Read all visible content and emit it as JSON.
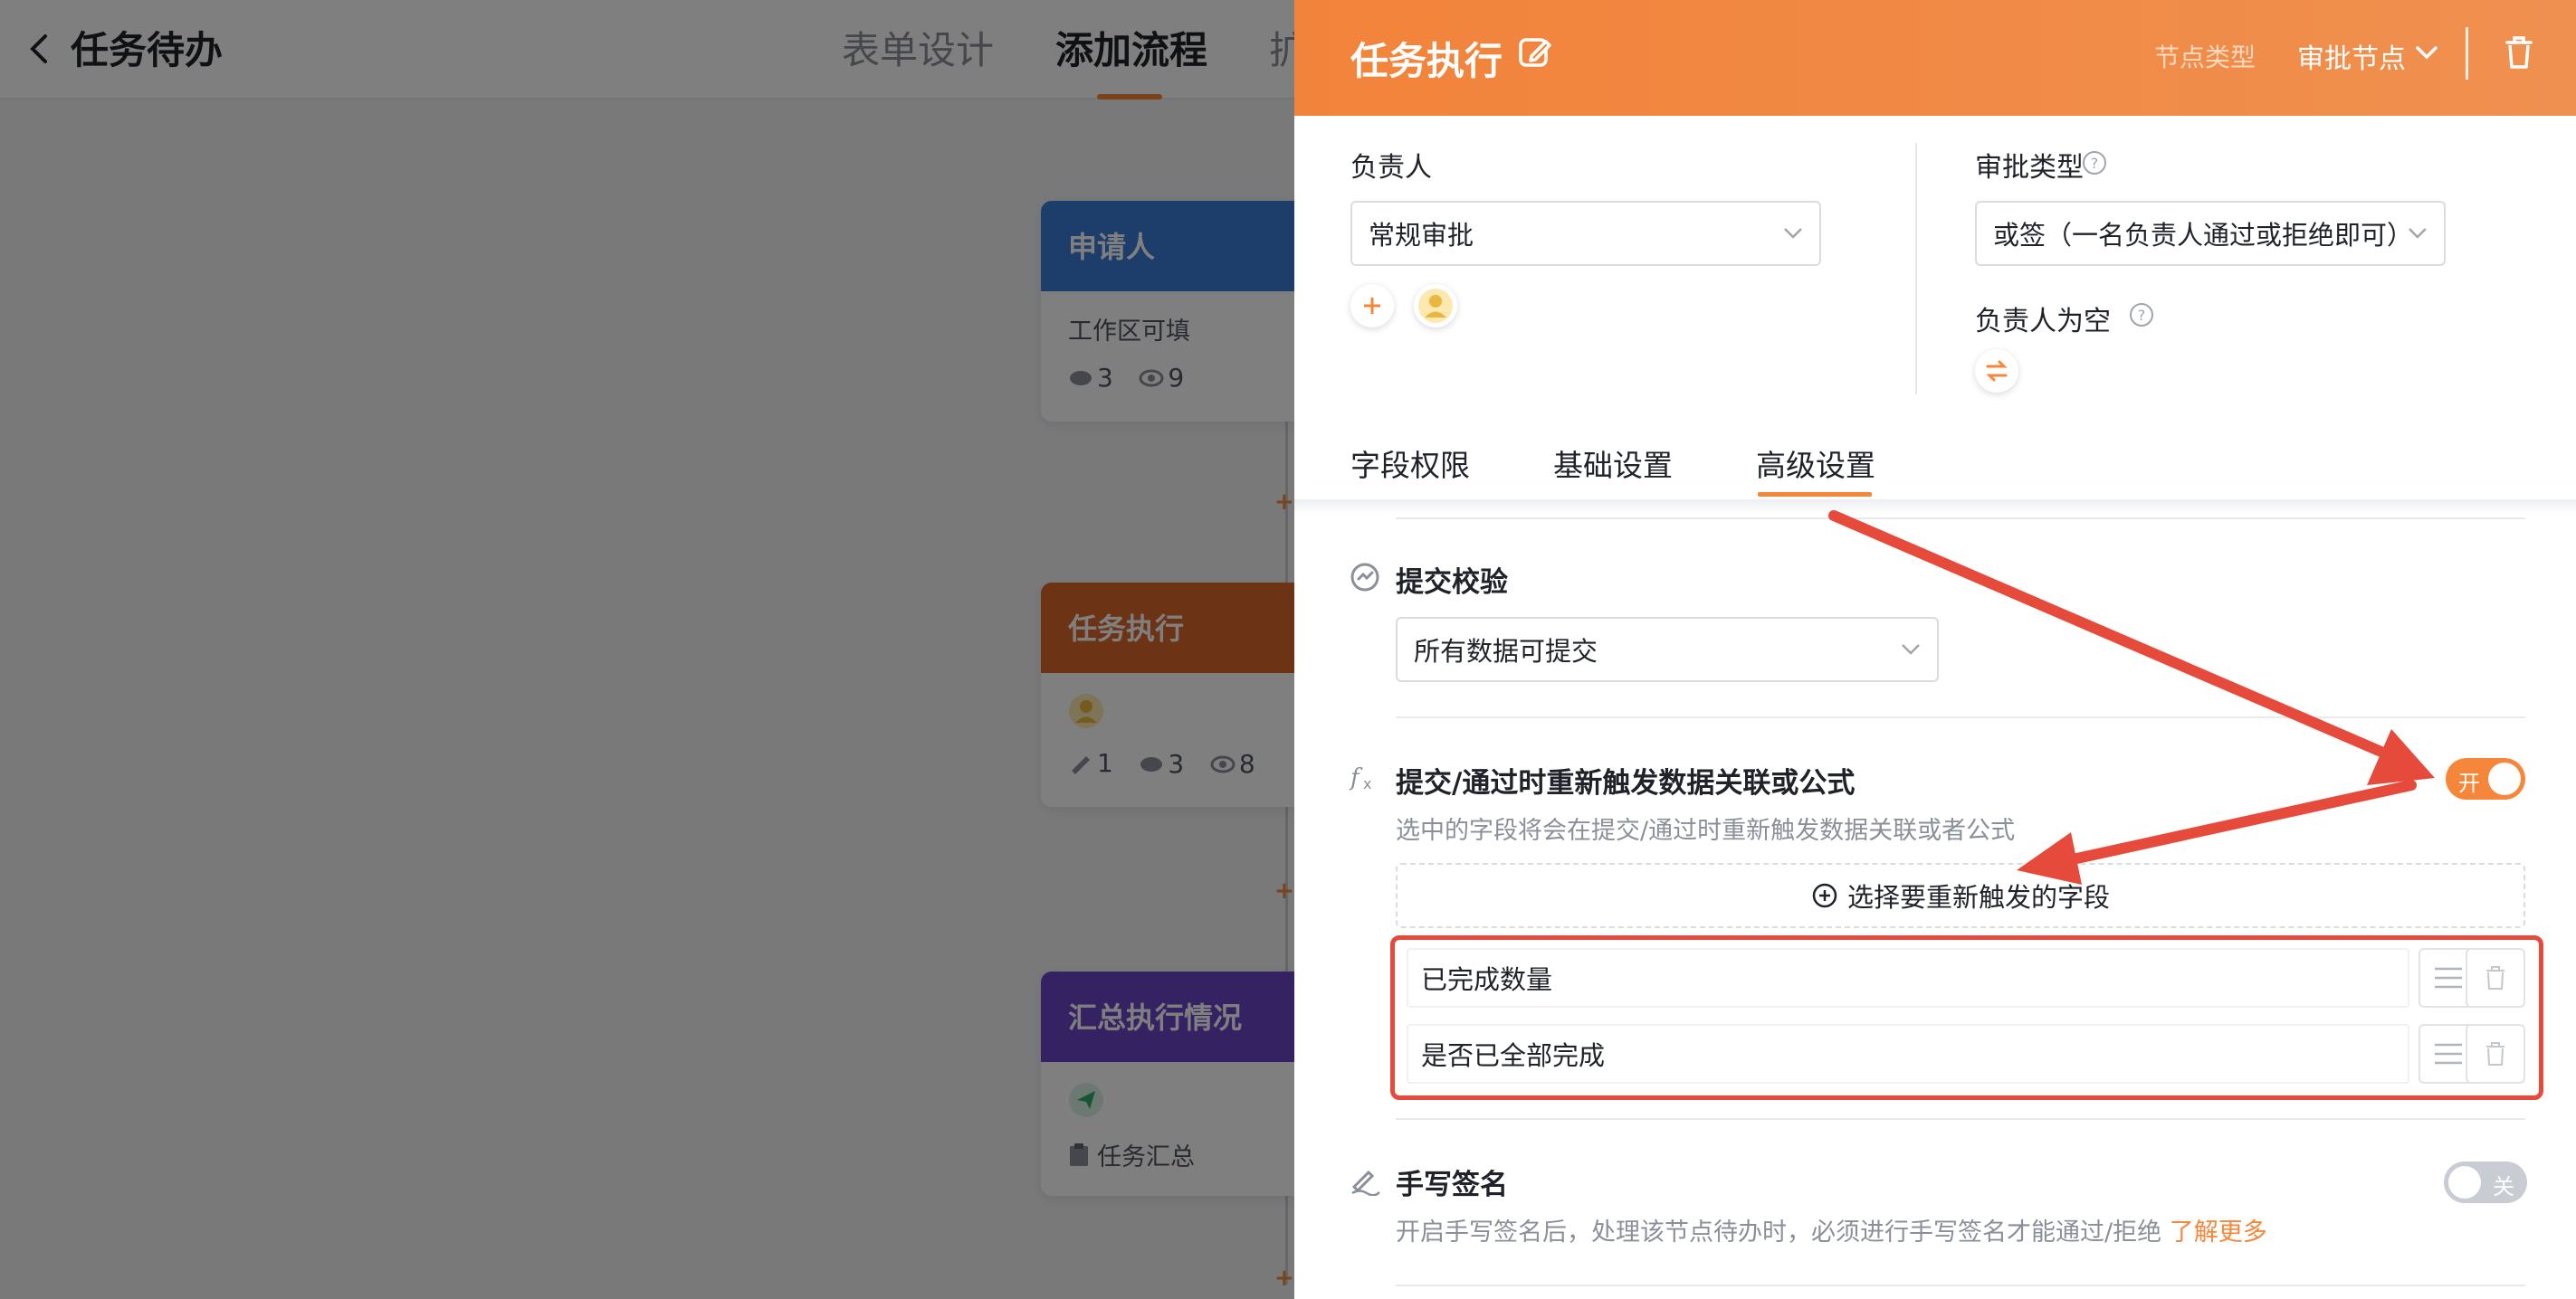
{
  "topbar": {
    "title": "任务待办",
    "tabs": [
      {
        "label": "表单设计",
        "active": false
      },
      {
        "label": "添加流程",
        "active": true
      },
      {
        "label": "扩",
        "active": false
      }
    ]
  },
  "flow_cards": [
    {
      "title": "申请人",
      "color": "#3a7bd5",
      "body_text": "工作区可填",
      "stats": [
        "3",
        "9"
      ]
    },
    {
      "title": "任务执行",
      "color": "#d9662a",
      "stats": [
        "1",
        "3",
        "8"
      ]
    },
    {
      "title": "汇总执行情况",
      "color": "#6b45c4",
      "footer_text": "任务汇总"
    }
  ],
  "drawer": {
    "title": "任务执行",
    "node_type_label": "节点类型",
    "node_type_value": "审批节点",
    "assignee": {
      "label": "负责人",
      "value": "常规审批"
    },
    "approval_type": {
      "label": "审批类型",
      "value": "或签（一名负责人通过或拒绝即可）"
    },
    "empty_assignee": {
      "label": "负责人为空"
    },
    "tabs": [
      {
        "label": "字段权限",
        "active": false
      },
      {
        "label": "基础设置",
        "active": false
      },
      {
        "label": "高级设置",
        "active": true
      }
    ],
    "submit_check": {
      "title": "提交校验",
      "value": "所有数据可提交"
    },
    "retrigger": {
      "title": "提交/通过时重新触发数据关联或公式",
      "description": "选中的字段将会在提交/通过时重新触发数据关联或者公式",
      "toggle_label": "开",
      "enabled": true,
      "add_button": "选择要重新触发的字段",
      "fields": [
        "已完成数量",
        "是否已全部完成"
      ]
    },
    "signature": {
      "title": "手写签名",
      "description": "开启手写签名后，处理该节点待办时，必须进行手写签名才能通过/拒绝",
      "link": "了解更多",
      "toggle_label": "关",
      "enabled": false
    }
  },
  "colors": {
    "accent": "#f5863a",
    "annotation": "#e64a3a"
  }
}
